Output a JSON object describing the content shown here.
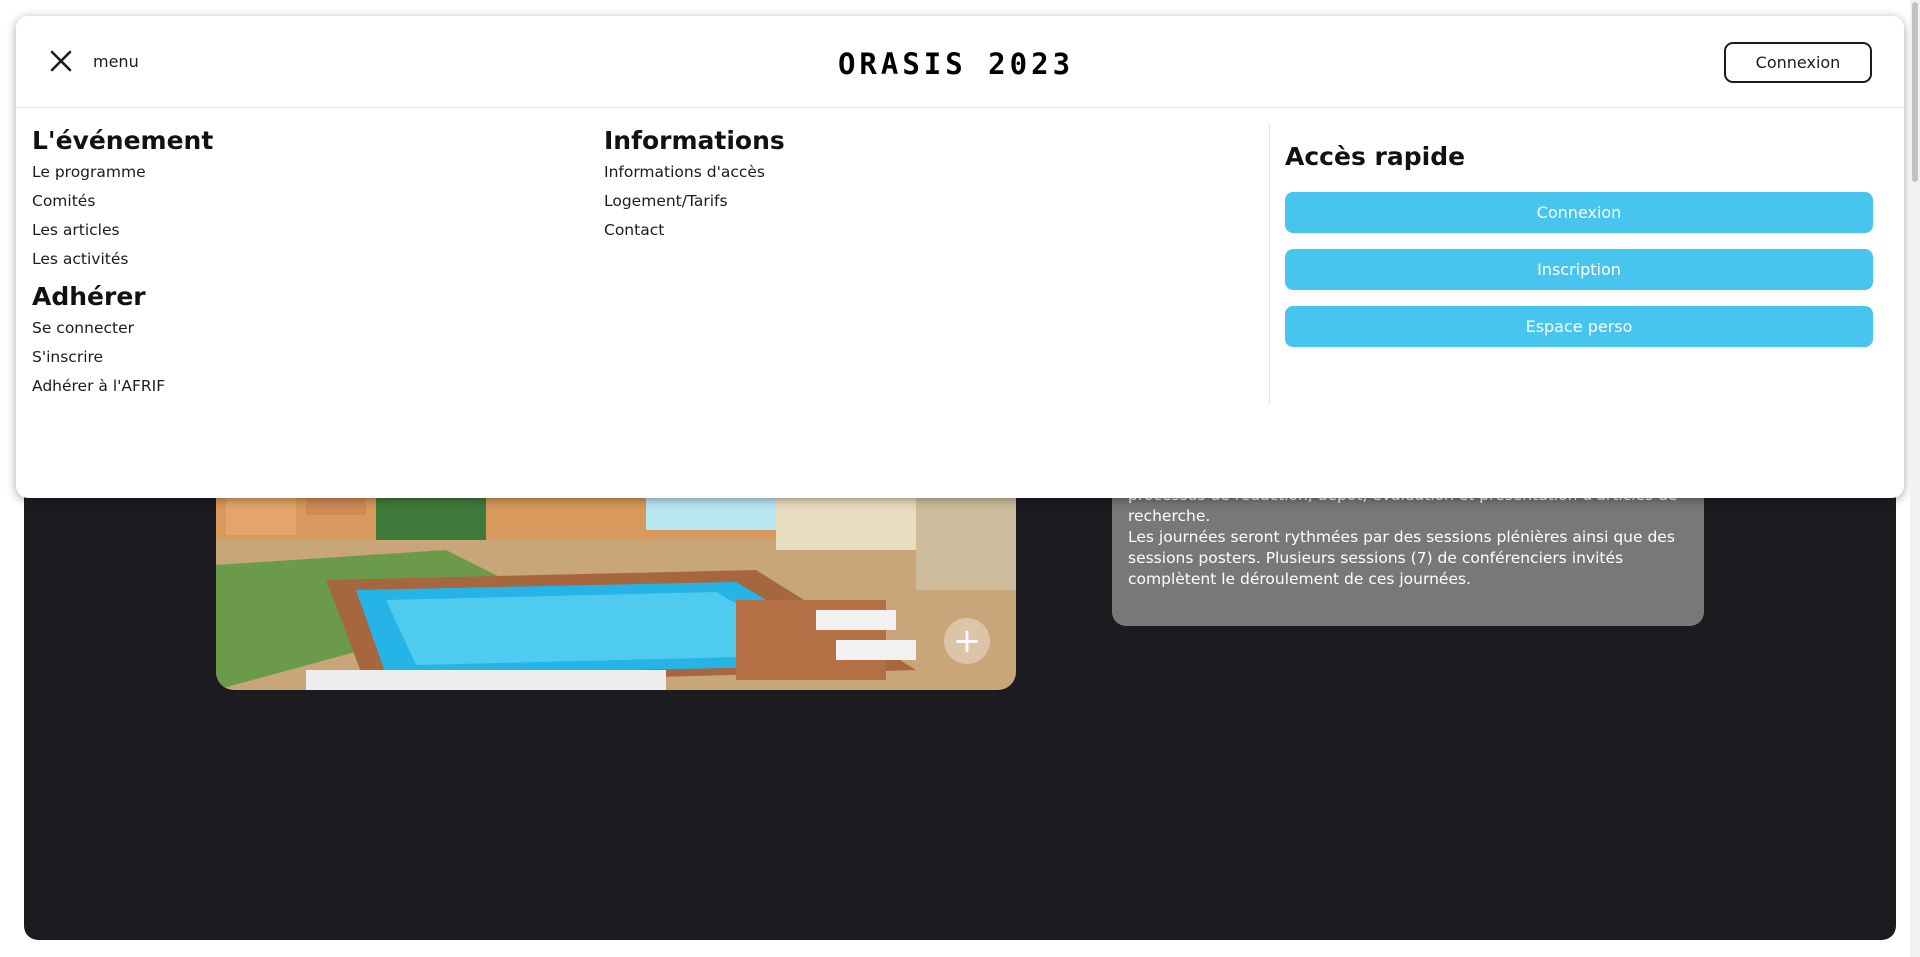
{
  "header": {
    "menu_label": "menu",
    "logo_text": "ORASIS 2023",
    "login_label": "Connexion"
  },
  "columns": {
    "event": {
      "title": "L'événement",
      "links": [
        "Le programme",
        "Comités",
        "Les articles",
        "Les activités"
      ]
    },
    "member": {
      "title": "Adhérer",
      "links": [
        "Se connecter",
        "S'inscrire",
        "Adhérer à l'AFRIF"
      ]
    },
    "info": {
      "title": "Informations",
      "links": [
        "Informations d'accès",
        "Logement/Tarifs",
        "Contact"
      ]
    },
    "quick": {
      "title": "Accès rapide",
      "buttons": [
        "Connexion",
        "Inscription",
        "Espace perso"
      ]
    }
  },
  "background": {
    "info_lines": [
      "processus de rédaction, dépôt, évaluation et présentation d'articles de recherche.",
      "Les journées seront rythmées par des sessions plénières ainsi que des sessions posters. Plusieurs sessions (7) de conférenciers invités complètent le déroulement de ces journées."
    ]
  },
  "colors": {
    "accent": "#48c5ef",
    "dark_bg": "#1c1b1f",
    "card_bg": "#787878"
  },
  "icons": {
    "close": "close-icon",
    "plus": "plus-icon"
  }
}
